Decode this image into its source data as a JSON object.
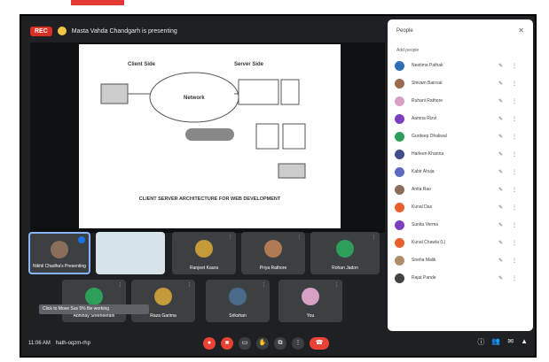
{
  "meeting": {
    "rec_label": "REC",
    "presenting_text": "Masta Vahda Chandgarh is presenting",
    "slide_title": "CLIENT SERVER ARCHITECTURE FOR WEB DEVELOPMENT",
    "slide_labels": {
      "client": "Client Side",
      "server": "Server Side",
      "network": "Network"
    },
    "toast": "Click to Move Sus 5% file working",
    "time": "11:06 AM",
    "meeting_code": "hath-oqzm-rhp"
  },
  "tiles": [
    {
      "name": "Nikhil Chadha's Presenting",
      "mic": "⋮"
    },
    {
      "name": "",
      "mic": ""
    },
    {
      "name": "Ranjeet Kaura",
      "mic": "⋮"
    },
    {
      "name": "Priya Rathore",
      "mic": "⋮"
    },
    {
      "name": "Rohan Jadon",
      "mic": "⋮"
    },
    {
      "name": "Abhinay Sreeneerani",
      "mic": "⋮"
    },
    {
      "name": "Raza Garima",
      "mic": "⋮"
    },
    {
      "name": "Srikshan",
      "mic": "⋮"
    },
    {
      "name": "You",
      "mic": "⋮"
    }
  ],
  "panel": {
    "title": "People",
    "add_label": "Add people",
    "participants": [
      {
        "name": "Neetima Pathak",
        "color": "#2f6fb3"
      },
      {
        "name": "Shivam Bainsal",
        "color": "#9b6b4f"
      },
      {
        "name": "Ruhani Rathore",
        "color": "#d9a0c5"
      },
      {
        "name": "Aamna Rizvi",
        "color": "#7b3fbf"
      },
      {
        "name": "Gurdeep Dhaliwal",
        "color": "#2e9e5b"
      },
      {
        "name": "Harleen Khanna",
        "color": "#3f4d8a"
      },
      {
        "name": "Kabir Ahuja",
        "color": "#5c6bc0"
      },
      {
        "name": "Anita Rao",
        "color": "#8a6d5a"
      },
      {
        "name": "Kunal Das",
        "color": "#e8612c"
      },
      {
        "name": "Sunita Verma",
        "color": "#7b3fbf"
      },
      {
        "name": "Kunal Chawla (L)",
        "color": "#e8612c"
      },
      {
        "name": "Sneha Malik",
        "color": "#b08d6a"
      },
      {
        "name": "Rajat Pande",
        "color": "#444"
      }
    ]
  }
}
